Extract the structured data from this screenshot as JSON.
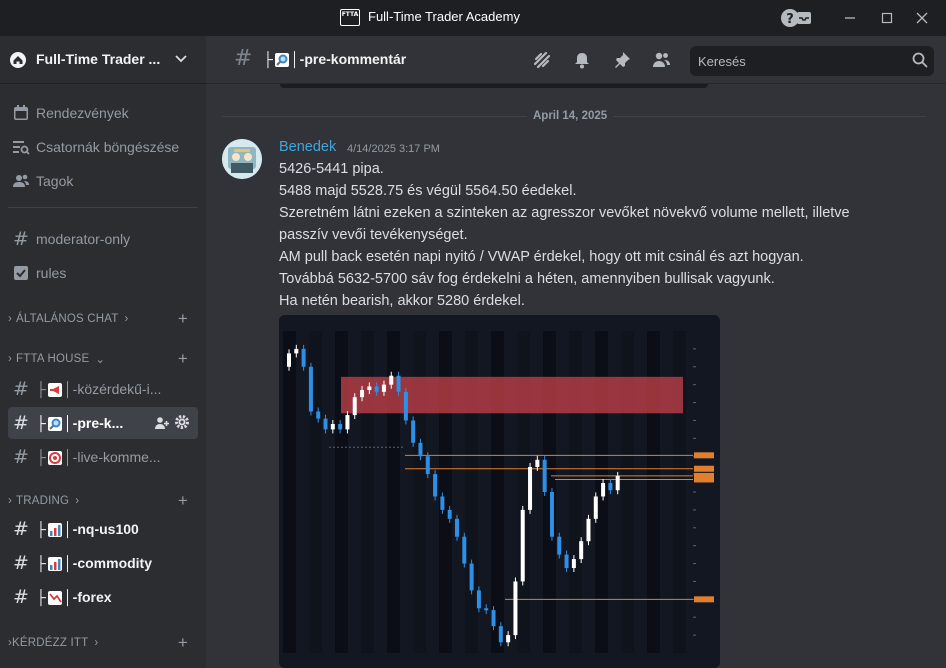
{
  "window": {
    "title": "Full-Time Trader Academy",
    "logo_text": "FTTA",
    "icons": [
      "inbox-icon",
      "help-icon",
      "minimize-icon",
      "maximize-icon",
      "close-icon"
    ]
  },
  "sidebar": {
    "server_name": "Full-Time Trader ...",
    "top_items": [
      {
        "label": "Rendezvények",
        "icon": "calendar-icon"
      },
      {
        "label": "Csatornák böngészése",
        "icon": "browse-channels-icon"
      },
      {
        "label": "Tagok",
        "icon": "members-icon"
      }
    ],
    "channels_top": [
      {
        "label": "moderator-only",
        "icon": "hash-icon"
      },
      {
        "label": "rules",
        "icon": "rules-icon"
      }
    ],
    "categories": [
      {
        "label": "ÁLTALÁNOS CHAT",
        "chevron": "›"
      },
      {
        "label": "FTTA HOUSE",
        "chevron": "⌄"
      },
      {
        "label": "TRADING",
        "chevron": "›"
      },
      {
        "label": "KÉRDÉZZ ITT",
        "chevron": "›"
      }
    ],
    "ftta_channels": [
      {
        "prefix": "├",
        "emoji": "megaphone-icon",
        "label": "-közérdekű-i...",
        "active": false
      },
      {
        "prefix": "├",
        "emoji": "magnifier-icon",
        "label": "-pre-k...",
        "active": true
      },
      {
        "prefix": "├",
        "emoji": "target-icon",
        "label": "-live-komme...",
        "active": false
      }
    ],
    "trading_channels": [
      {
        "prefix": "├",
        "emoji": "chart-icon",
        "label": "-nq-us100"
      },
      {
        "prefix": "├",
        "emoji": "chart-icon",
        "label": "-commodity"
      },
      {
        "prefix": "├",
        "emoji": "chart-down-icon",
        "label": "-forex"
      }
    ],
    "pipe": "│"
  },
  "header": {
    "channel_prefix": "├",
    "channel_name": "-pre-kommentár",
    "pipe": "│",
    "search_placeholder": "Keresés"
  },
  "messages": {
    "date_divider": "April 14, 2025",
    "author": "Benedek",
    "author_color": "#3ea6de",
    "timestamp": "4/14/2025 3:17 PM",
    "lines": [
      "5426-5441 pipa.",
      "5488 majd 5528.75 és végül 5564.50 éedekel.",
      "Szeretném látni ezeken a szinteken az agresszor vevőket növekvő volume mellett, illetve",
      "passzív vevői tevékenységet.",
      "AM pull back esetén napi nyitó / VWAP érdekel, hogy ott mit csinál és azt hogyan.",
      "Továbbá 5632-5700 sáv fog érdekelni a héten, amennyiben bullisak vagyunk.",
      "Ha netén bearish, akkor 5280 érdekel."
    ]
  },
  "chart_data": {
    "type": "candlestick",
    "up_color": "#ffffff",
    "down_color": "#2e8fe6",
    "zone_color": "#c8414a",
    "level_color": "#e0802e",
    "candles": [
      {
        "o": 5540,
        "c": 5555
      },
      {
        "o": 5555,
        "c": 5560
      },
      {
        "o": 5560,
        "c": 5540
      },
      {
        "o": 5540,
        "c": 5490
      },
      {
        "o": 5490,
        "c": 5482
      },
      {
        "o": 5482,
        "c": 5470
      },
      {
        "o": 5470,
        "c": 5476
      },
      {
        "o": 5476,
        "c": 5470
      },
      {
        "o": 5470,
        "c": 5486
      },
      {
        "o": 5486,
        "c": 5506
      },
      {
        "o": 5506,
        "c": 5514
      },
      {
        "o": 5514,
        "c": 5518
      },
      {
        "o": 5518,
        "c": 5512
      },
      {
        "o": 5512,
        "c": 5520
      },
      {
        "o": 5520,
        "c": 5530
      },
      {
        "o": 5530,
        "c": 5512
      },
      {
        "o": 5512,
        "c": 5480
      },
      {
        "o": 5480,
        "c": 5455
      },
      {
        "o": 5455,
        "c": 5440
      },
      {
        "o": 5440,
        "c": 5420
      },
      {
        "o": 5420,
        "c": 5395
      },
      {
        "o": 5395,
        "c": 5380
      },
      {
        "o": 5380,
        "c": 5370
      },
      {
        "o": 5370,
        "c": 5350
      },
      {
        "o": 5350,
        "c": 5320
      },
      {
        "o": 5320,
        "c": 5290
      },
      {
        "o": 5290,
        "c": 5270
      },
      {
        "o": 5270,
        "c": 5268
      },
      {
        "o": 5268,
        "c": 5250
      },
      {
        "o": 5250,
        "c": 5232
      },
      {
        "o": 5232,
        "c": 5240
      },
      {
        "o": 5240,
        "c": 5300
      },
      {
        "o": 5300,
        "c": 5380
      },
      {
        "o": 5380,
        "c": 5428
      },
      {
        "o": 5428,
        "c": 5436
      },
      {
        "o": 5436,
        "c": 5400
      },
      {
        "o": 5400,
        "c": 5350
      },
      {
        "o": 5350,
        "c": 5330
      },
      {
        "o": 5330,
        "c": 5315
      },
      {
        "o": 5315,
        "c": 5325
      },
      {
        "o": 5325,
        "c": 5345
      },
      {
        "o": 5345,
        "c": 5370
      },
      {
        "o": 5370,
        "c": 5395
      },
      {
        "o": 5395,
        "c": 5410
      },
      {
        "o": 5410,
        "c": 5402
      },
      {
        "o": 5402,
        "c": 5418
      }
    ],
    "zone": [
      5488,
      5528.75
    ],
    "levels": [
      5441,
      5426,
      5418,
      5414,
      5280
    ],
    "ylim": [
      5220,
      5580
    ]
  }
}
